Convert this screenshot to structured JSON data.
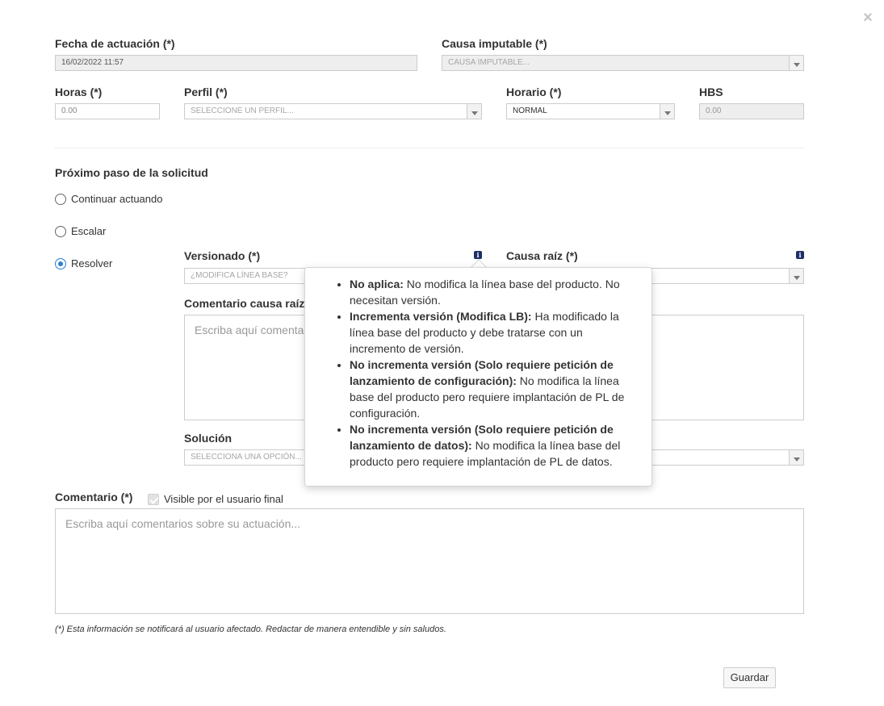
{
  "dialog": {
    "close_symbol": "×"
  },
  "fecha": {
    "label": "Fecha de actuación (*)",
    "value": "16/02/2022 11:57"
  },
  "causa_imputable": {
    "label": "Causa imputable (*)",
    "placeholder": "CAUSA IMPUTABLE..."
  },
  "horas": {
    "label": "Horas (*)",
    "value": "0.00"
  },
  "perfil": {
    "label": "Perfil (*)",
    "placeholder": "SELECCIONE UN PERFIL..."
  },
  "horario": {
    "label": "Horario (*)",
    "value": "NORMAL"
  },
  "hbs": {
    "label": "HBS",
    "value": "0.00"
  },
  "proximo_paso": {
    "title": "Próximo paso de la solicitud",
    "options": [
      {
        "label": "Continuar actuando",
        "checked": false
      },
      {
        "label": "Escalar",
        "checked": false
      },
      {
        "label": "Resolver",
        "checked": true
      }
    ]
  },
  "versionado": {
    "label": "Versionado (*)",
    "placeholder": "¿MODIFICA LÍNEA BASE?",
    "info_glyph": "i"
  },
  "causa_raiz": {
    "label": "Causa raíz (*)",
    "info_glyph": "i"
  },
  "comentario_causa_raiz": {
    "label": "Comentario causa raíz (",
    "placeholder": "Escriba aquí comenta"
  },
  "solucion": {
    "label": "Solución",
    "placeholder": "SELECCIONA UNA OPCIÓN..."
  },
  "comentario": {
    "label": "Comentario (*)",
    "visible_label": "Visible por el usuario final",
    "visible_checked": true,
    "placeholder": "Escriba aquí comentarios sobre su actuación..."
  },
  "footnote": "(*) Esta información se notificará al usuario afectado. Redactar de manera entendible y sin saludos.",
  "save_label": "Guardar",
  "popover": {
    "items": [
      {
        "term": "No aplica:",
        "text": " No modifica la línea base del producto. No necesitan versión."
      },
      {
        "term": "Incrementa versión (Modifica LB):",
        "text": " Ha modificado la línea base del producto y debe tratarse con un incremento de versión."
      },
      {
        "term": "No incrementa versión (Solo requiere petición de lanzamiento de configuración):",
        "text": " No modifica la línea base del producto pero requiere implantación de PL de configuración."
      },
      {
        "term": "No incrementa versión (Solo requiere petición de lanzamiento de datos):",
        "text": " No modifica la línea base del producto pero requiere implantación de PL de datos."
      }
    ]
  }
}
